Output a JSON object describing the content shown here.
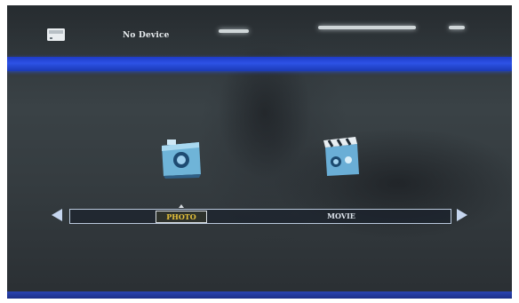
{
  "header": {
    "device_status": "No Device",
    "device_icon": "storage-device-icon"
  },
  "menu": {
    "items": [
      {
        "label": "PHOTO",
        "icon": "photo-camera-icon",
        "selected": true
      },
      {
        "label": "MOVIE",
        "icon": "movie-clapper-icon",
        "selected": false
      }
    ],
    "left_arrow_icon": "arrow-left-icon",
    "right_arrow_icon": "arrow-right-icon"
  },
  "colors": {
    "accent_band": "#2d52e6",
    "selected_text": "#e6c23a",
    "menu_text": "#dfe6ee"
  }
}
